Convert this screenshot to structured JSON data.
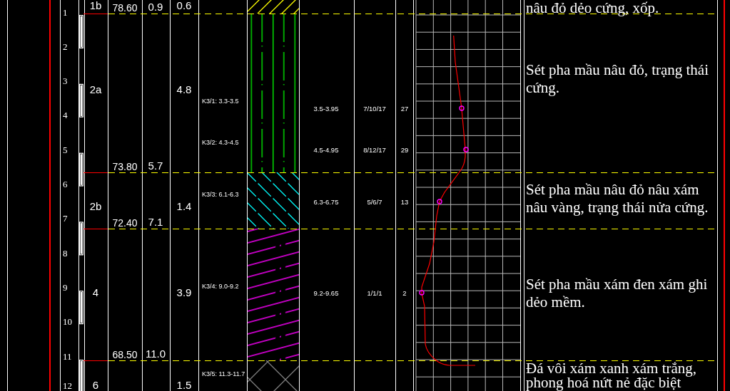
{
  "depth_scale": [
    "1",
    "2",
    "3",
    "4",
    "5",
    "6",
    "7",
    "8",
    "9",
    "10",
    "11",
    "12"
  ],
  "layers": [
    {
      "number": "1b",
      "thickness": "0.6",
      "elevation": "78.60",
      "depth": "0.9",
      "kind": "slash",
      "description": "nâu đỏ dẻo cứng, xốp."
    },
    {
      "number": "2a",
      "thickness": "4.8",
      "elevation": "73.80",
      "depth": "5.7",
      "kind": "dashdot",
      "description": "Sét pha mầu nâu đỏ, trạng thái cứng."
    },
    {
      "number": "2b",
      "thickness": "1.4",
      "elevation": "72.40",
      "depth": "7.1",
      "kind": "backslash",
      "description": "Sét pha mầu nâu đỏ nâu xám nâu vàng, trạng thái nửa cứng."
    },
    {
      "number": "4",
      "thickness": "3.9",
      "elevation": "68.50",
      "depth": "11.0",
      "kind": "dash",
      "description": "Sét pha mầu xám đen xám ghi dẻo mềm."
    },
    {
      "number": "6",
      "thickness": "1.5",
      "kind": "cross",
      "description": "Đá vôi xám xanh xám trắng, phong hoá nứt nẻ đặc biệt"
    }
  ],
  "samples": [
    "K3/1: 3.3-3.5",
    "K3/2: 4.3-4.5",
    "K3/3: 6.1-6.3",
    "K3/4: 9.0-9.2",
    "K3/5: 11.3-11.7"
  ],
  "spt": [
    {
      "interval": "3.5-3.95",
      "blows": "7/10/17",
      "n": "27"
    },
    {
      "interval": "4.5-4.95",
      "blows": "8/12/17",
      "n": "29"
    },
    {
      "interval": "6.3-6.75",
      "blows": "5/6/7",
      "n": "13"
    },
    {
      "interval": "9.2-9.65",
      "blows": "1/1/1",
      "n": "2"
    }
  ]
}
